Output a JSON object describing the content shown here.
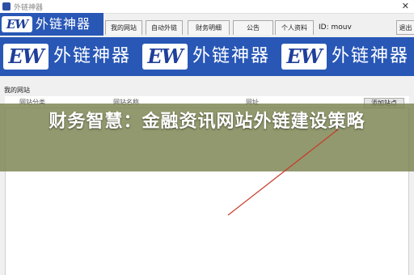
{
  "window": {
    "title": "外链神器"
  },
  "brand": {
    "logo_mark": "EW",
    "logo_text": "外链神器"
  },
  "tabs": [
    {
      "label": "我的网站"
    },
    {
      "label": "自动外链"
    },
    {
      "label": "财务明细"
    },
    {
      "label": "公告"
    },
    {
      "label": "个人资料"
    }
  ],
  "user": {
    "id_text": "ID: mouv"
  },
  "toolbar": {
    "exit_label": "退出"
  },
  "panel": {
    "group_label": "我的网站",
    "columns": [
      "网站分类",
      "网站名称",
      "网址"
    ],
    "add_button_label": "添加站点"
  },
  "overlay": {
    "title": "财务智慧：金融资讯网站外链建设策略"
  },
  "colors": {
    "banner_blue": "#2857b6",
    "overlay_olive": "#7a824e",
    "line_red": "#c83a2a"
  }
}
